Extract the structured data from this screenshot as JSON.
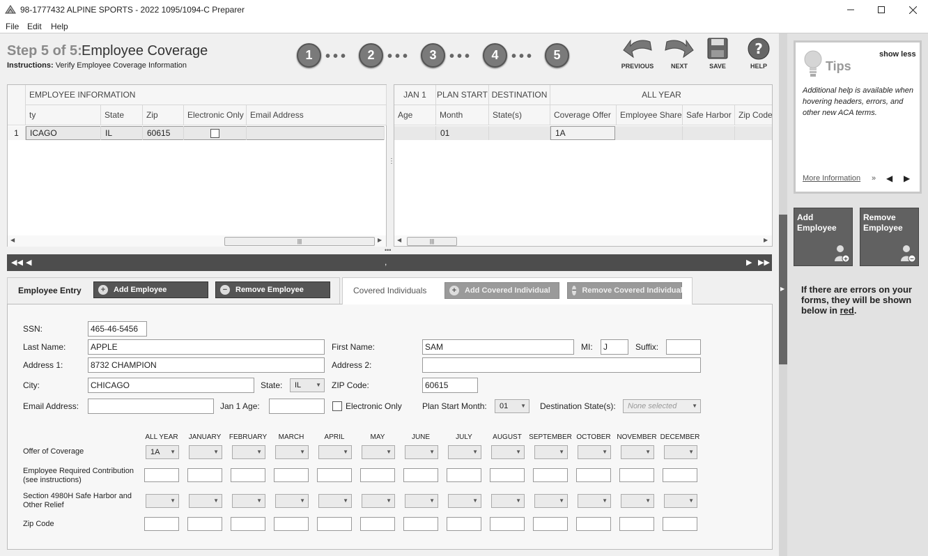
{
  "window": {
    "title": "98-1777432 ALPINE SPORTS - 2022 1095/1094-C Preparer"
  },
  "menu": [
    "File",
    "Edit",
    "Help"
  ],
  "header": {
    "step_label": "Step 5 of 5:",
    "title": "Employee Coverage",
    "instructions_label": "Instructions:",
    "instructions": "Verify Employee Coverage Information"
  },
  "steps": [
    "1",
    "2",
    "3",
    "4",
    "5"
  ],
  "nav": {
    "previous": "PREVIOUS",
    "next": "NEXT",
    "save": "SAVE",
    "help": "HELP"
  },
  "left_grid": {
    "group_header": "EMPLOYEE INFORMATION",
    "columns": [
      "ty",
      "State",
      "Zip",
      "Electronic Only",
      "Email Address"
    ],
    "rows": [
      {
        "num": "1",
        "city": "ICAGO",
        "state": "IL",
        "zip": "60615",
        "electronic_only": false,
        "email": ""
      }
    ]
  },
  "right_grid": {
    "group_headers": [
      "JAN 1",
      "PLAN START",
      "DESTINATION",
      "ALL YEAR"
    ],
    "columns": [
      "Age",
      "Month",
      "State(s)",
      "Coverage Offer",
      "Employee Share",
      "Safe Harbor",
      "Zip Code"
    ],
    "rows": [
      {
        "age": "",
        "month": "01",
        "states": "",
        "coverage_offer": "1A",
        "employee_share": "",
        "safe_harbor": "",
        "zip": ""
      }
    ]
  },
  "pager": {
    "center": ","
  },
  "employee_tab": {
    "label": "Employee Entry",
    "add": "Add Employee",
    "remove": "Remove Employee"
  },
  "covered_tab": {
    "label": "Covered Individuals",
    "add": "Add Covered Individual",
    "remove": "Remove Covered Individual"
  },
  "form": {
    "ssn_label": "SSN:",
    "ssn": "465-46-5456",
    "last_name_label": "Last Name:",
    "last_name": "APPLE",
    "first_name_label": "First Name:",
    "first_name": "SAM",
    "mi_label": "MI:",
    "mi": "J",
    "suffix_label": "Suffix:",
    "suffix": "",
    "address1_label": "Address 1:",
    "address1": "8732 CHAMPION",
    "address2_label": "Address 2:",
    "address2": "",
    "city_label": "City:",
    "city": "CHICAGO",
    "state_label": "State:",
    "state": "IL",
    "zip_label": "ZIP Code:",
    "zip": "60615",
    "email_label": "Email Address:",
    "email": "",
    "age_label": "Jan 1 Age:",
    "age": "",
    "electronic_only_label": "Electronic Only",
    "plan_start_label": "Plan Start Month:",
    "plan_start": "01",
    "dest_label": "Destination State(s):",
    "dest_placeholder": "None selected"
  },
  "months": {
    "headers": [
      "ALL YEAR",
      "JANUARY",
      "FEBRUARY",
      "MARCH",
      "APRIL",
      "MAY",
      "JUNE",
      "JULY",
      "AUGUST",
      "SEPTEMBER",
      "OCTOBER",
      "NOVEMBER",
      "DECEMBER"
    ],
    "row_labels": {
      "offer": "Offer of Coverage",
      "contribution_1": "Employee Required Contribution",
      "contribution_2": "(see instructions)",
      "safe_harbor_1": "Section 4980H Safe Harbor and",
      "safe_harbor_2": "Other Relief",
      "zip": "Zip Code"
    },
    "offer_values": [
      "1A",
      "",
      "",
      "",
      "",
      "",
      "",
      "",
      "",
      "",
      "",
      "",
      ""
    ]
  },
  "tips": {
    "title": "Tips",
    "toggle": "show less",
    "text": "Additional help is available when hovering headers, errors, and other new ACA terms.",
    "more": "More Information",
    "more_suffix": "»"
  },
  "side_buttons": {
    "add": "Add Employee",
    "remove": "Remove Employee"
  },
  "errors_note": {
    "text": "If there are errors on your forms, they will be shown below in",
    "link": "red",
    "end": "."
  }
}
